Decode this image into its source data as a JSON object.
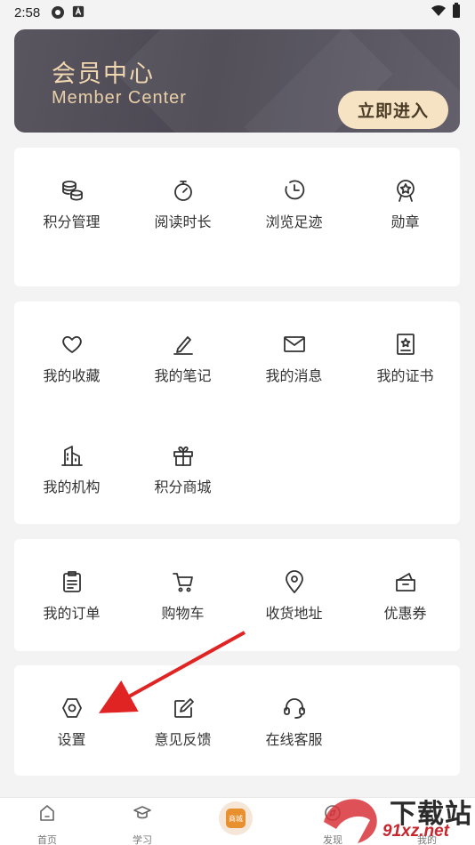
{
  "status_bar": {
    "time": "2:58"
  },
  "banner": {
    "title": "会员中心",
    "subtitle": "Member Center",
    "button_label": "立即进入"
  },
  "section1": {
    "items": [
      {
        "label": "积分管理",
        "icon": "coins-stack-icon"
      },
      {
        "label": "阅读时长",
        "icon": "stopwatch-icon"
      },
      {
        "label": "浏览足迹",
        "icon": "history-clock-icon"
      },
      {
        "label": "勋章",
        "icon": "medal-icon"
      }
    ]
  },
  "section2": {
    "items": [
      {
        "label": "我的收藏",
        "icon": "heart-icon"
      },
      {
        "label": "我的笔记",
        "icon": "pencil-icon"
      },
      {
        "label": "我的消息",
        "icon": "mail-icon"
      },
      {
        "label": "我的证书",
        "icon": "certificate-icon"
      },
      {
        "label": "我的机构",
        "icon": "building-icon"
      },
      {
        "label": "积分商城",
        "icon": "gift-icon"
      }
    ]
  },
  "section3": {
    "items": [
      {
        "label": "我的订单",
        "icon": "clipboard-list-icon"
      },
      {
        "label": "购物车",
        "icon": "shopping-cart-icon"
      },
      {
        "label": "收货地址",
        "icon": "location-pin-icon"
      },
      {
        "label": "优惠券",
        "icon": "coupon-icon"
      }
    ]
  },
  "section4": {
    "items": [
      {
        "label": "设置",
        "icon": "hexagon-settings-icon"
      },
      {
        "label": "意见反馈",
        "icon": "edit-feedback-icon"
      },
      {
        "label": "在线客服",
        "icon": "headset-icon"
      }
    ]
  },
  "bottom_nav": {
    "items": [
      {
        "label": "首页",
        "icon": "home-icon"
      },
      {
        "label": "学习",
        "icon": "graduation-cap-icon"
      },
      {
        "label": "商城",
        "icon": "mall-icon"
      },
      {
        "label": "发现",
        "icon": "compass-icon"
      },
      {
        "label": "我的",
        "icon": "user-icon"
      }
    ]
  },
  "watermark": {
    "text": "下载站",
    "url": "91xz.net"
  },
  "colors": {
    "banner_gold": "#f1d7b0",
    "arrow_red": "#e02424",
    "mall_orange": "#e9902e"
  }
}
